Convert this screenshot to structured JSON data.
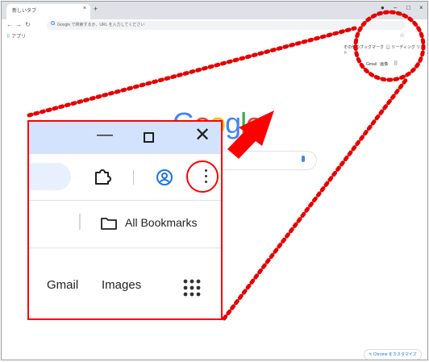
{
  "browser": {
    "tab_title": "新しいタブ",
    "tab_close": "×",
    "new_tab": "+",
    "window_controls": {
      "minimize": "–",
      "maximize": "□",
      "close": "×"
    },
    "omnibox_g": "G",
    "omnibox_placeholder": "Google で検索するか、URL を入力してください",
    "bookmarks_apps_label": "アプリ",
    "bookmarks_right_1": "その他のブックマーク",
    "bookmarks_right_2": "リーディング リスト",
    "top_links": {
      "gmail": "Gmail",
      "images": "画像"
    },
    "customize_label": "Chrome をカスタマイズ"
  },
  "google_logo": {
    "letters": [
      "G",
      "o",
      "o",
      "g",
      "l",
      "e"
    ],
    "colors": [
      "#4285f4",
      "#ea4335",
      "#fbbc05",
      "#4285f4",
      "#34a853",
      "#ea4335"
    ]
  },
  "zoom": {
    "minimize": "—",
    "close": "✕",
    "all_bookmarks": "All Bookmarks",
    "gmail": "Gmail",
    "images": "Images"
  },
  "colors": {
    "highlight_red": "#ff0000",
    "zoom_titlebar": "#d3e3fd"
  }
}
